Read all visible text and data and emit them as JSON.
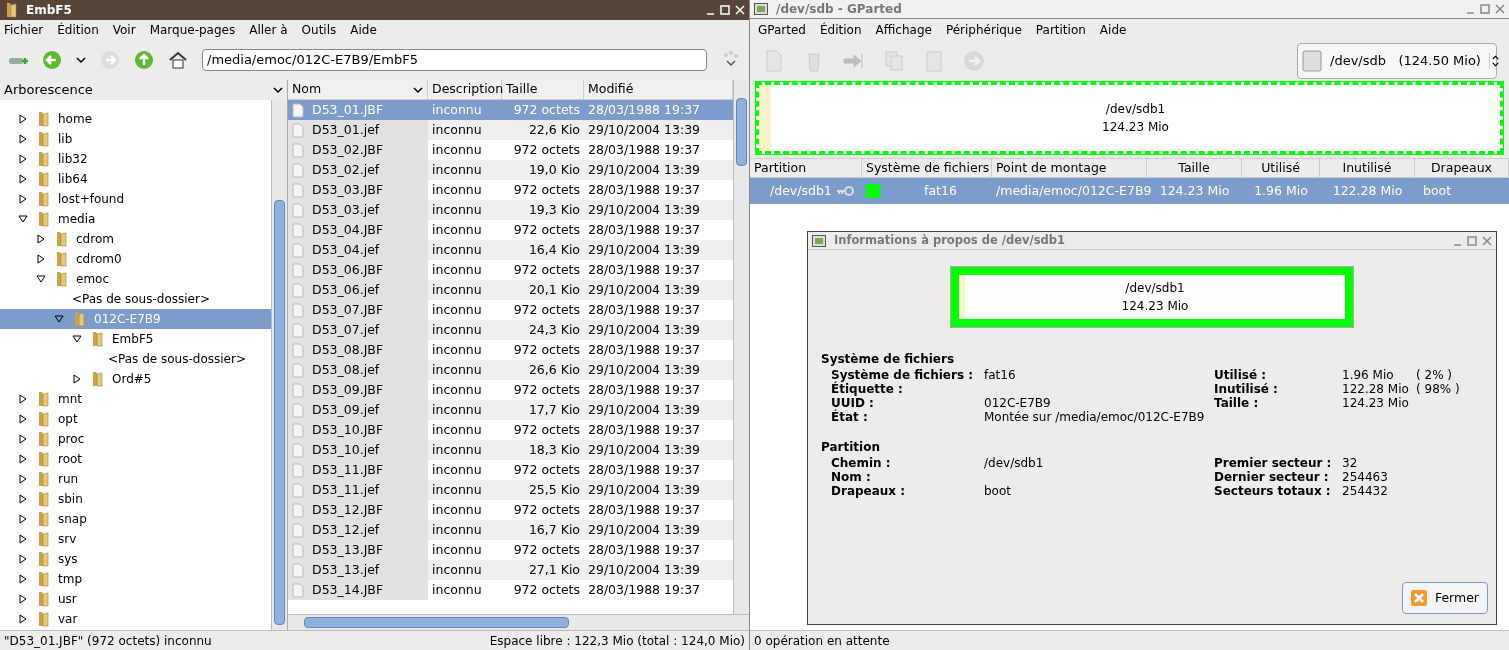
{
  "file_manager": {
    "title": "EmbF5",
    "menu": [
      "Fichier",
      "Édition",
      "Voir",
      "Marque-pages",
      "Aller à",
      "Outils",
      "Aide"
    ],
    "address": "/media/emoc/012C-E7B9/EmbF5",
    "tree_header": "Arborescence",
    "tree": [
      {
        "kind": "folder",
        "label": "home",
        "expanded": false,
        "selected": false
      },
      {
        "kind": "folder",
        "label": "lib",
        "expanded": false,
        "selected": false
      },
      {
        "kind": "folder",
        "label": "lib32",
        "expanded": false,
        "selected": false
      },
      {
        "kind": "folder",
        "label": "lib64",
        "expanded": false,
        "selected": false
      },
      {
        "kind": "folder",
        "label": "lost+found",
        "expanded": false,
        "selected": false
      },
      {
        "kind": "folder",
        "label": "media",
        "expanded": true,
        "selected": false,
        "children": [
          {
            "kind": "folder",
            "label": "cdrom",
            "expanded": false,
            "selected": false
          },
          {
            "kind": "folder",
            "label": "cdrom0",
            "expanded": false,
            "selected": false
          },
          {
            "kind": "folder",
            "label": "emoc",
            "expanded": true,
            "selected": false,
            "children": [
              {
                "kind": "placeholder",
                "label": "<Pas de sous-dossier>"
              },
              {
                "kind": "folder",
                "label": "012C-E7B9",
                "expanded": true,
                "selected": true,
                "children": [
                  {
                    "kind": "folder",
                    "label": "EmbF5",
                    "expanded": true,
                    "selected": false,
                    "children": [
                      {
                        "kind": "placeholder",
                        "label": "<Pas de sous-dossier>"
                      }
                    ]
                  },
                  {
                    "kind": "folder",
                    "label": "Ord#5",
                    "expanded": false,
                    "selected": false
                  }
                ]
              }
            ]
          }
        ]
      },
      {
        "kind": "folder",
        "label": "mnt",
        "expanded": false,
        "selected": false
      },
      {
        "kind": "folder",
        "label": "opt",
        "expanded": false,
        "selected": false
      },
      {
        "kind": "folder",
        "label": "proc",
        "expanded": false,
        "selected": false
      },
      {
        "kind": "folder",
        "label": "root",
        "expanded": false,
        "selected": false
      },
      {
        "kind": "folder",
        "label": "run",
        "expanded": false,
        "selected": false
      },
      {
        "kind": "folder",
        "label": "sbin",
        "expanded": false,
        "selected": false
      },
      {
        "kind": "folder",
        "label": "snap",
        "expanded": false,
        "selected": false
      },
      {
        "kind": "folder",
        "label": "srv",
        "expanded": false,
        "selected": false
      },
      {
        "kind": "folder",
        "label": "sys",
        "expanded": false,
        "selected": false
      },
      {
        "kind": "folder",
        "label": "tmp",
        "expanded": false,
        "selected": false
      },
      {
        "kind": "folder",
        "label": "usr",
        "expanded": false,
        "selected": false
      },
      {
        "kind": "folder",
        "label": "var",
        "expanded": false,
        "selected": false
      }
    ],
    "columns": [
      "Nom",
      "Description",
      "Taille",
      "Modifié"
    ],
    "files": [
      {
        "name": "D53_01.JBF",
        "description": "inconnu",
        "size": "972 octets",
        "modified": "28/03/1988 19:37",
        "selected": true
      },
      {
        "name": "D53_01.jef",
        "description": "inconnu",
        "size": "22,6 Kio",
        "modified": "29/10/2004 13:39",
        "selected": false
      },
      {
        "name": "D53_02.JBF",
        "description": "inconnu",
        "size": "972 octets",
        "modified": "28/03/1988 19:37",
        "selected": false
      },
      {
        "name": "D53_02.jef",
        "description": "inconnu",
        "size": "19,0 Kio",
        "modified": "29/10/2004 13:39",
        "selected": false
      },
      {
        "name": "D53_03.JBF",
        "description": "inconnu",
        "size": "972 octets",
        "modified": "28/03/1988 19:37",
        "selected": false
      },
      {
        "name": "D53_03.jef",
        "description": "inconnu",
        "size": "19,3 Kio",
        "modified": "29/10/2004 13:39",
        "selected": false
      },
      {
        "name": "D53_04.JBF",
        "description": "inconnu",
        "size": "972 octets",
        "modified": "28/03/1988 19:37",
        "selected": false
      },
      {
        "name": "D53_04.jef",
        "description": "inconnu",
        "size": "16,4 Kio",
        "modified": "29/10/2004 13:39",
        "selected": false
      },
      {
        "name": "D53_06.JBF",
        "description": "inconnu",
        "size": "972 octets",
        "modified": "28/03/1988 19:37",
        "selected": false
      },
      {
        "name": "D53_06.jef",
        "description": "inconnu",
        "size": "20,1 Kio",
        "modified": "29/10/2004 13:39",
        "selected": false
      },
      {
        "name": "D53_07.JBF",
        "description": "inconnu",
        "size": "972 octets",
        "modified": "28/03/1988 19:37",
        "selected": false
      },
      {
        "name": "D53_07.jef",
        "description": "inconnu",
        "size": "24,3 Kio",
        "modified": "29/10/2004 13:39",
        "selected": false
      },
      {
        "name": "D53_08.JBF",
        "description": "inconnu",
        "size": "972 octets",
        "modified": "28/03/1988 19:37",
        "selected": false
      },
      {
        "name": "D53_08.jef",
        "description": "inconnu",
        "size": "26,6 Kio",
        "modified": "29/10/2004 13:39",
        "selected": false
      },
      {
        "name": "D53_09.JBF",
        "description": "inconnu",
        "size": "972 octets",
        "modified": "28/03/1988 19:37",
        "selected": false
      },
      {
        "name": "D53_09.jef",
        "description": "inconnu",
        "size": "17,7 Kio",
        "modified": "29/10/2004 13:39",
        "selected": false
      },
      {
        "name": "D53_10.JBF",
        "description": "inconnu",
        "size": "972 octets",
        "modified": "28/03/1988 19:37",
        "selected": false
      },
      {
        "name": "D53_10.jef",
        "description": "inconnu",
        "size": "18,3 Kio",
        "modified": "29/10/2004 13:39",
        "selected": false
      },
      {
        "name": "D53_11.JBF",
        "description": "inconnu",
        "size": "972 octets",
        "modified": "28/03/1988 19:37",
        "selected": false
      },
      {
        "name": "D53_11.jef",
        "description": "inconnu",
        "size": "25,5 Kio",
        "modified": "29/10/2004 13:39",
        "selected": false
      },
      {
        "name": "D53_12.JBF",
        "description": "inconnu",
        "size": "972 octets",
        "modified": "28/03/1988 19:37",
        "selected": false
      },
      {
        "name": "D53_12.jef",
        "description": "inconnu",
        "size": "16,7 Kio",
        "modified": "29/10/2004 13:39",
        "selected": false
      },
      {
        "name": "D53_13.JBF",
        "description": "inconnu",
        "size": "972 octets",
        "modified": "28/03/1988 19:37",
        "selected": false
      },
      {
        "name": "D53_13.jef",
        "description": "inconnu",
        "size": "27,1 Kio",
        "modified": "29/10/2004 13:39",
        "selected": false
      },
      {
        "name": "D53_14.JBF",
        "description": "inconnu",
        "size": "972 octets",
        "modified": "28/03/1988 19:37",
        "selected": false
      }
    ],
    "status_left": "\"D53_01.JBF\" (972 octets) inconnu",
    "status_right": "Espace libre : 122,3 Mio (total : 124,0 Mio)"
  },
  "gparted": {
    "title": "/dev/sdb - GParted",
    "menu": [
      "GParted",
      "Édition",
      "Affichage",
      "Périphérique",
      "Partition",
      "Aide"
    ],
    "device": "/dev/sdb   (124.50 Mio)",
    "partition_bar": {
      "name": "/dev/sdb1",
      "size": "124.23 Mio"
    },
    "columns": [
      "Partition",
      "Système de fichiers",
      "Point de montage",
      "Taille",
      "Utilisé",
      "Inutilisé",
      "Drapeaux"
    ],
    "partitions": [
      {
        "partition": "/dev/sdb1",
        "color": "#00ff00",
        "filesystem": "fat16",
        "mount": "/media/emoc/012C-E7B9",
        "size": "124.23 Mio",
        "used": "1.96 Mio",
        "unused": "122.28 Mio",
        "flags": "boot",
        "selected": true
      }
    ],
    "status": "0 opération en attente"
  },
  "dialog": {
    "title": "Informations à propos de /dev/sdb1",
    "graph": {
      "name": "/dev/sdb1",
      "size": "124.23 Mio"
    },
    "sections": [
      {
        "title": "Système de fichiers",
        "left": [
          {
            "label": "Système de fichiers :",
            "value": "fat16"
          },
          {
            "label": "Étiquette :"
          },
          {
            "label": "UUID :",
            "value": "012C-E7B9"
          },
          {
            "label": "État :",
            "value": "Montée sur /media/emoc/012C-E7B9"
          }
        ],
        "right": [
          {
            "label": "Utilisé :",
            "value": "1.96 Mio",
            "percent": "( 2% )"
          },
          {
            "label": "Inutilisé :",
            "value": "122.28 Mio",
            "percent": "( 98% )"
          },
          {
            "label": "Taille :",
            "value": "124.23 Mio"
          }
        ]
      },
      {
        "title": "Partition",
        "left": [
          {
            "label": "Chemin :",
            "value": "/dev/sdb1"
          },
          {
            "label": "Nom :"
          },
          {
            "label": "Drapeaux :",
            "value": "boot"
          }
        ],
        "right": [
          {
            "label": "Premier secteur :",
            "value": "32"
          },
          {
            "label": "Dernier secteur :",
            "value": "254463"
          },
          {
            "label": "Secteurs totaux :",
            "value": "254432"
          }
        ]
      }
    ],
    "close_button": "Fermer"
  }
}
